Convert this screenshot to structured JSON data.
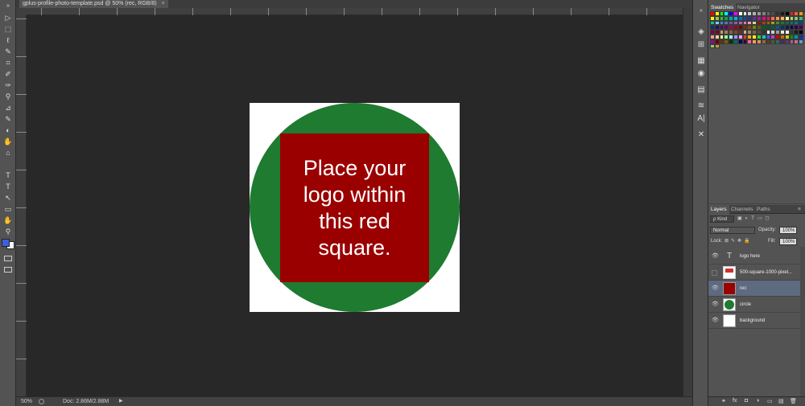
{
  "document": {
    "tab_label": "gplus-profile-photo-template.psd @ 50% (rec, RGB/8)",
    "tab_close": "×"
  },
  "canvas": {
    "text": "Place your logo within this red square.",
    "background_color": "#ffffff",
    "circle_color": "#1e7b30",
    "square_color": "#9a0000"
  },
  "status": {
    "zoom": "50%",
    "doc_info": "Doc: 2.86M/2.88M",
    "arrow": "▶"
  },
  "toolbar": {
    "collapse": "»",
    "tools": [
      "▷",
      "⬚",
      "ℓ",
      "✎",
      "⌗",
      "✐",
      "✑",
      "⚲",
      "⊿",
      "✎",
      "◐",
      "✋",
      "⌂",
      "T",
      "↖",
      "▭",
      "✋",
      "⚲"
    ]
  },
  "top_panel": {
    "tabs": [
      "Swatches",
      "Navigator"
    ],
    "menu": "≡"
  },
  "swatches": [
    "#ff0000",
    "#ffff00",
    "#00ff00",
    "#00ffff",
    "#0000ff",
    "#ff00ff",
    "#ffffff",
    "#e6e6e6",
    "#cccccc",
    "#b3b3b3",
    "#999999",
    "#808080",
    "#666666",
    "#4d4d4d",
    "#333333",
    "#1a1a1a",
    "#000000",
    "#ee1d24",
    "#f26522",
    "#f7941d",
    "#fff200",
    "#8dc63f",
    "#39b54a",
    "#00a651",
    "#00a99d",
    "#00aeef",
    "#0072bc",
    "#0054a6",
    "#2e3192",
    "#662d91",
    "#92278f",
    "#ec008c",
    "#ed145b",
    "#f26c4f",
    "#f68e56",
    "#fbaf5d",
    "#fff799",
    "#acd373",
    "#7cc576",
    "#3cb878",
    "#1abc9c",
    "#6dcff6",
    "#448ccb",
    "#5674b9",
    "#605ca8",
    "#8560a8",
    "#a864a8",
    "#f06eaa",
    "#f49ac2",
    "#c4df9b",
    "#9e0b0f",
    "#a0410d",
    "#a36209",
    "#aba000",
    "#598527",
    "#197b30",
    "#007236",
    "#00746b",
    "#0076a3",
    "#004a80",
    "#003471",
    "#1b1464",
    "#440e62",
    "#630460",
    "#9e005d",
    "#a0001f",
    "#790000",
    "#7b2e00",
    "#7d4900",
    "#827b00",
    "#406618",
    "#005e20",
    "#005826",
    "#005952",
    "#005b7f",
    "#003663",
    "#002157",
    "#0d004c",
    "#32004b",
    "#4b0049",
    "#7b0046",
    "#7a0026",
    "#c69c6d",
    "#a67c52",
    "#8c6239",
    "#754c24",
    "#603913",
    "#c7b299",
    "#998675",
    "#736357",
    "#534741",
    "#37302d",
    "#ffffff",
    "#cccccc",
    "#999999",
    "#e6e6e6",
    "#f2f2f2",
    "#333333",
    "#1a1a1a",
    "#000000",
    "#ff9999",
    "#ffcc99",
    "#ffff99",
    "#99ff99",
    "#99ffff",
    "#9999ff",
    "#ff99ff",
    "#ff3333",
    "#ffaa00",
    "#ffee00",
    "#33cc33",
    "#00cccc",
    "#3366ff",
    "#cc33cc",
    "#cc0000",
    "#cc6600",
    "#cccc00",
    "#009900",
    "#009999",
    "#0033cc",
    "#990099",
    "#660000",
    "#663300",
    "#666600",
    "#003300",
    "#006666",
    "#000066",
    "#330033",
    "#ff6699",
    "#ff9966",
    "#cc9966",
    "#996633",
    "#663333",
    "#336633",
    "#336666",
    "#333366",
    "#663366",
    "#996699",
    "#cc6699",
    "#6699cc",
    "#99cc66",
    "#cc9933"
  ],
  "layers_panel": {
    "tabs": [
      "Layers",
      "Channels",
      "Paths"
    ],
    "kind_label": "ρ Kind",
    "blend_mode": "Normal",
    "opacity_label": "Opacity:",
    "opacity_value": "100%",
    "lock_label": "Lock:",
    "fill_label": "Fill:",
    "fill_value": "100%",
    "layers": [
      {
        "name": "logo here",
        "type": "text",
        "thumb": "T",
        "visible": true,
        "selected": false
      },
      {
        "name": "500-square-1000-pixel...",
        "type": "smart",
        "thumb": "",
        "visible": false,
        "selected": false
      },
      {
        "name": "rec",
        "type": "shape",
        "thumb": "",
        "visible": true,
        "selected": true
      },
      {
        "name": "circle",
        "type": "shape",
        "thumb": "",
        "visible": true,
        "selected": false
      },
      {
        "name": "background",
        "type": "image",
        "thumb": "",
        "visible": true,
        "selected": false
      }
    ],
    "bottom_icons": [
      "⚭",
      "fx",
      "◘",
      "◑",
      "▭",
      "▤",
      "🗑"
    ]
  },
  "icon_strip": [
    "◈",
    "⊞",
    "▦",
    "◉",
    "▤",
    "≋",
    "A|",
    "¶",
    "✕"
  ]
}
